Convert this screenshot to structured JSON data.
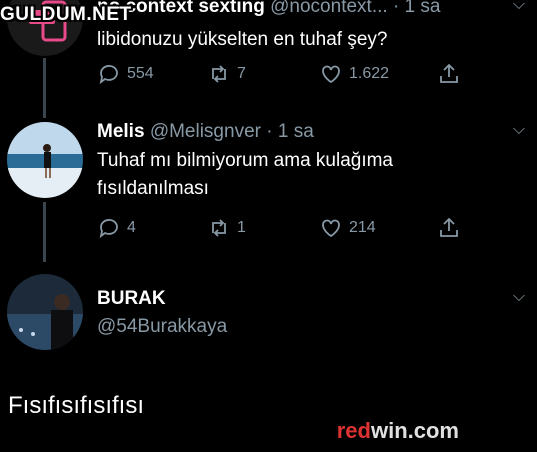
{
  "watermark_top": "GULDUM.NET",
  "watermark_bottom": {
    "part1": "red",
    "part2": "win.com"
  },
  "tweets": [
    {
      "name": "no context sexting",
      "handle": "@nocontext...",
      "time": "· 1 sa",
      "text": "libidonuzu yükselten en tuhaf şey?",
      "replies": "554",
      "retweets": "7",
      "likes": "1.622"
    },
    {
      "name": "Melis",
      "handle": "@Melisgnver",
      "time": "· 1 sa",
      "text": "Tuhaf mı bilmiyorum ama kulağıma fısıldanılması",
      "replies": "4",
      "retweets": "1",
      "likes": "214"
    },
    {
      "name": "BURAK",
      "handle": "@54Burakkaya"
    }
  ],
  "reply_text": "Fısıfısıfısıfısı",
  "colors": {
    "background": "#000000",
    "secondary_text": "#8899a6",
    "thread_line": "#3a444d"
  }
}
